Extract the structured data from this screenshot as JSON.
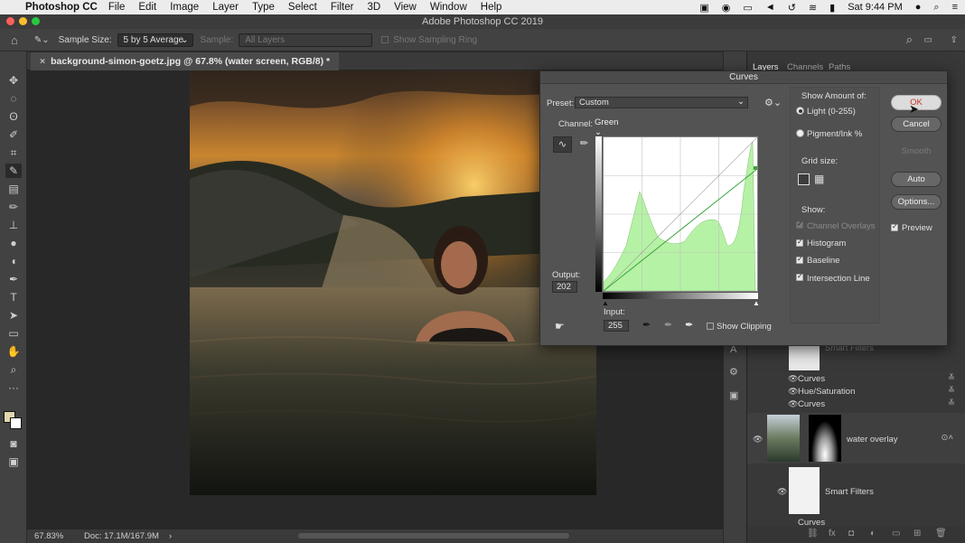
{
  "menubar": {
    "app": "Photoshop CC",
    "items": [
      "File",
      "Edit",
      "Image",
      "Layer",
      "Type",
      "Select",
      "Filter",
      "3D",
      "View",
      "Window",
      "Help"
    ],
    "clock": "Sat 9:44 PM"
  },
  "window": {
    "title": "Adobe Photoshop CC 2019"
  },
  "options_bar": {
    "sample_size_label": "Sample Size:",
    "sample_size_value": "5 by 5 Average",
    "sample_label": "Sample:",
    "sample_value": "All Layers",
    "show_sampling_ring": "Show Sampling Ring"
  },
  "document": {
    "tab_title": "background-simon-goetz.jpg @ 67.8% (water screen, RGB/8) *",
    "close_glyph": "×"
  },
  "status": {
    "zoom": "67.83%",
    "doc": "Doc: 17.1M/167.9M"
  },
  "panel_tabs": [
    "Layers",
    "Channels",
    "Paths"
  ],
  "layers": {
    "rows": [
      {
        "name": "Smart Filters"
      },
      {
        "name": "Curves"
      },
      {
        "name": "Hue/Saturation"
      },
      {
        "name": "Curves"
      },
      {
        "name": "water overlay"
      },
      {
        "name": "Smart Filters"
      },
      {
        "name": "Curves"
      }
    ]
  },
  "curves": {
    "title": "Curves",
    "preset_label": "Preset:",
    "preset_value": "Custom",
    "channel_label": "Channel:",
    "channel_value": "Green",
    "output_label": "Output:",
    "output_value": "202",
    "input_label": "Input:",
    "input_value": "255",
    "show_clipping": "Show Clipping",
    "show_amount_label": "Show Amount of:",
    "light_option": "Light  (0-255)",
    "pigment_option": "Pigment/Ink %",
    "grid_size_label": "Grid size:",
    "show_label": "Show:",
    "channel_overlays": "Channel Overlays",
    "histogram": "Histogram",
    "baseline": "Baseline",
    "intersection_line": "Intersection Line",
    "buttons": {
      "ok": "OK",
      "cancel": "Cancel",
      "smooth": "Smooth",
      "auto": "Auto",
      "options": "Options..."
    },
    "preview": "Preview"
  }
}
